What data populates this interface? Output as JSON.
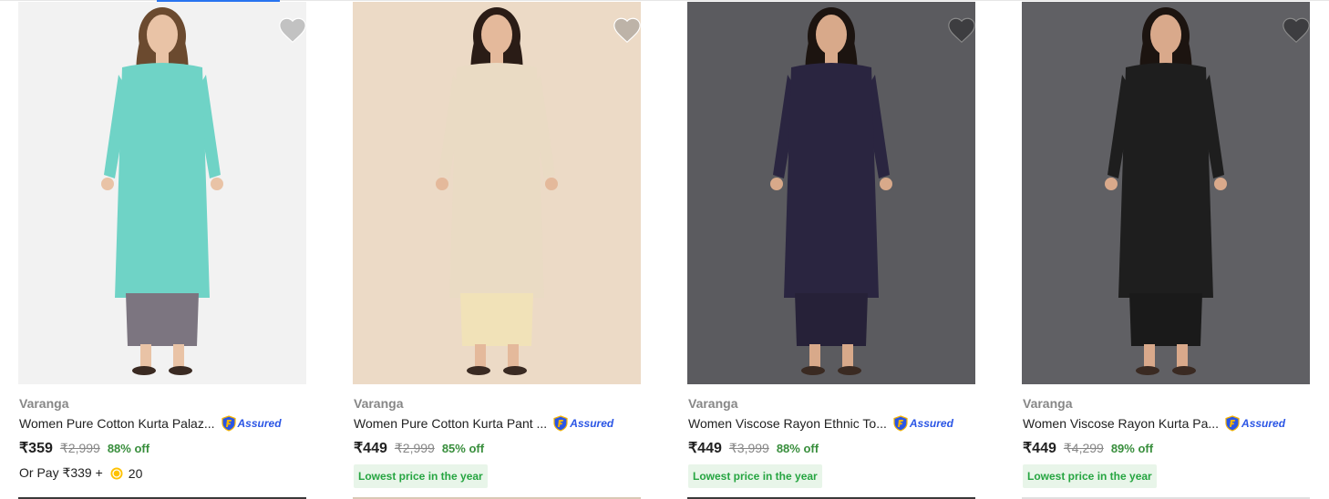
{
  "products": [
    {
      "brand": "Varanga",
      "title": "Women Pure Cotton Kurta Palaz...",
      "assured": "Assured",
      "price": "₹359",
      "mrp": "₹2,999",
      "discount": "88% off",
      "pay_label": "Or Pay ₹339 +",
      "coins": "20",
      "bg": "#f2f2f2",
      "top_color": "#6fd3c6",
      "bottom_color": "#7c7580",
      "skin": "#e9c3a6",
      "hair": "#6b4a2f"
    },
    {
      "brand": "Varanga",
      "title": "Women Pure Cotton Kurta Pant ...",
      "assured": "Assured",
      "price": "₹449",
      "mrp": "₹2,999",
      "discount": "85% off",
      "badge": "Lowest price in the year",
      "bg": "#ecdac6",
      "top_color": "#eadbc4",
      "bottom_color": "#f1e2b8",
      "skin": "#e4b99b",
      "hair": "#2a1c16"
    },
    {
      "brand": "Varanga",
      "title": "Women Viscose Rayon Ethnic To...",
      "assured": "Assured",
      "price": "₹449",
      "mrp": "₹3,999",
      "discount": "88% off",
      "badge": "Lowest price in the year",
      "bg": "#5b5b5f",
      "top_color": "#2a2540",
      "bottom_color": "#262138",
      "skin": "#d8a98a",
      "hair": "#1c1410"
    },
    {
      "brand": "Varanga",
      "title": "Women Viscose Rayon Kurta Pa...",
      "assured": "Assured",
      "price": "₹449",
      "mrp": "₹4,299",
      "discount": "89% off",
      "badge": "Lowest price in the year",
      "bg": "#606064",
      "top_color": "#1e1e1e",
      "bottom_color": "#1a1a1a",
      "skin": "#d9a98b",
      "hair": "#1c1410"
    }
  ]
}
